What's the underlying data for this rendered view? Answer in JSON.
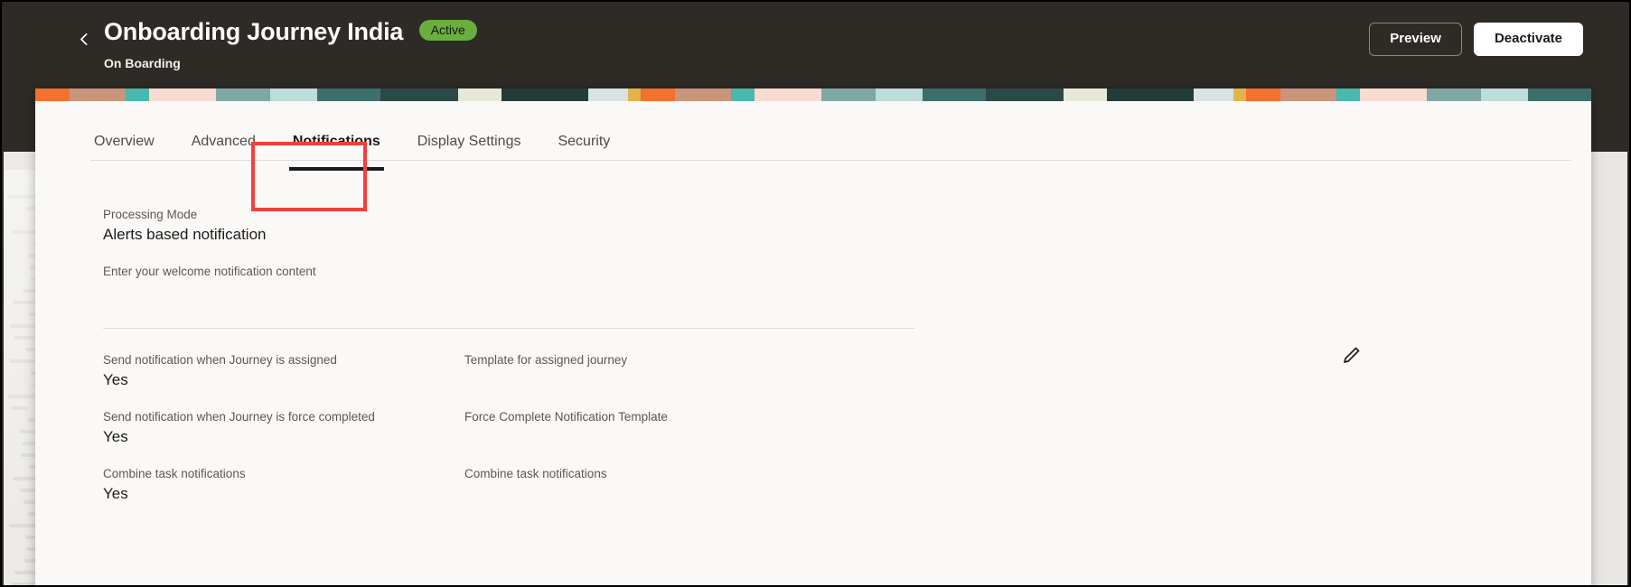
{
  "header": {
    "back_icon": "chevron-left-icon",
    "title": "Onboarding Journey India",
    "status": "Active",
    "status_color": "#6aae3f",
    "subtitle": "On Boarding",
    "preview_label": "Preview",
    "deactivate_label": "Deactivate"
  },
  "tabs": [
    {
      "label": "Overview",
      "active": false
    },
    {
      "label": "Advanced",
      "active": false
    },
    {
      "label": "Notifications",
      "active": true
    },
    {
      "label": "Display Settings",
      "active": false
    },
    {
      "label": "Security",
      "active": false
    }
  ],
  "highlight": {
    "target_tab": "Notifications",
    "color": "#f2403c"
  },
  "notifications": {
    "processing_mode_label": "Processing Mode",
    "processing_mode_value": "Alerts based notification",
    "welcome_hint": "Enter your welcome notification content",
    "edit_icon": "pencil-edit-icon",
    "rows": [
      {
        "left_label": "Send notification when Journey is assigned",
        "left_value": "Yes",
        "right_label": "Template for assigned journey",
        "right_value": ""
      },
      {
        "left_label": "Send notification when Journey is force completed",
        "left_value": "Yes",
        "right_label": "Force Complete Notification Template",
        "right_value": ""
      },
      {
        "left_label": "Combine task notifications",
        "left_value": "Yes",
        "right_label": "Combine task notifications",
        "right_value": ""
      }
    ]
  }
}
